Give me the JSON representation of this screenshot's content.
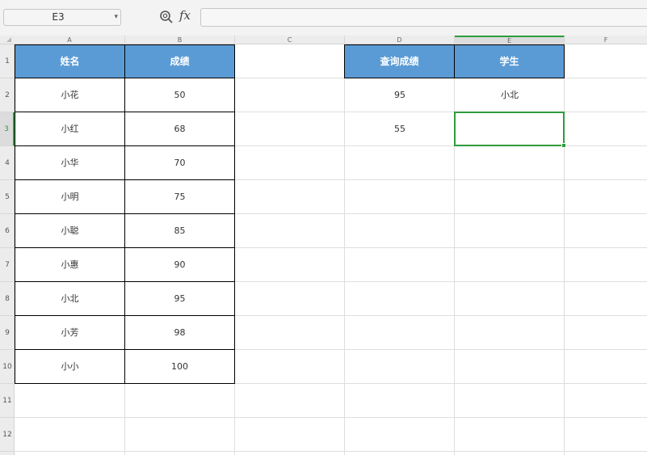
{
  "toolbar": {
    "name_box_value": "E3",
    "fx_label": "fx",
    "formula_value": ""
  },
  "columns": [
    "A",
    "B",
    "C",
    "D",
    "E",
    "F"
  ],
  "rows": [
    "1",
    "2",
    "3",
    "4",
    "5",
    "6",
    "7",
    "8",
    "9",
    "10",
    "11",
    "12"
  ],
  "active_cell": {
    "column": "E",
    "row": "3"
  },
  "cells": {
    "A1": "姓名",
    "B1": "成绩",
    "D1": "查询成绩",
    "E1": "学生",
    "A2": "小花",
    "B2": "50",
    "D2": "95",
    "E2": "小北",
    "A3": "小红",
    "B3": "68",
    "D3": "55",
    "E3": "",
    "A4": "小华",
    "B4": "70",
    "A5": "小明",
    "B5": "75",
    "A6": "小聪",
    "B6": "85",
    "A7": "小惠",
    "B7": "90",
    "A8": "小北",
    "B8": "95",
    "A9": "小芳",
    "B9": "98",
    "A10": "小小",
    "B10": "100"
  },
  "colors": {
    "header_fill": "#5b9bd5",
    "selection_border": "#2e9b3d"
  }
}
